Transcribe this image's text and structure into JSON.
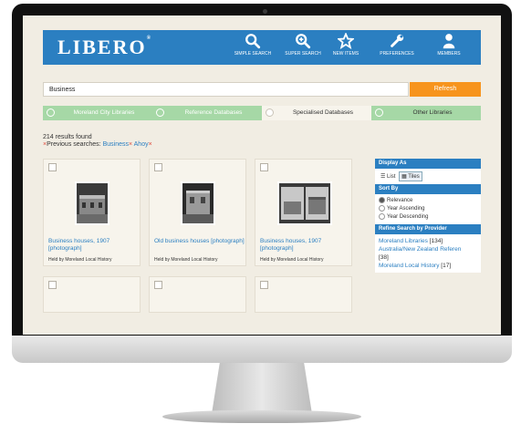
{
  "header": {
    "logo": "LIBERO",
    "nav": [
      {
        "label": "SIMPLE SEARCH",
        "icon": "search-icon"
      },
      {
        "label": "SUPER SEARCH",
        "icon": "zoom-plus-icon"
      },
      {
        "label": "NEW ITEMS",
        "icon": "star-icon"
      },
      {
        "label": "PREFERENCES",
        "icon": "wrench-icon"
      },
      {
        "label": "MEMBERS",
        "icon": "user-icon"
      }
    ]
  },
  "search": {
    "value": "Business",
    "refresh_label": "Refresh"
  },
  "databases": [
    {
      "label": "Moreland City Libraries",
      "selected": true
    },
    {
      "label": "Reference Databases",
      "selected": true
    },
    {
      "label": "Specialised Databases",
      "selected": false
    },
    {
      "label": "Other Libraries",
      "selected": true
    }
  ],
  "results": {
    "count_text": "214 results found",
    "prev_label": "Previous searches:",
    "prev_items": [
      "Business",
      "Ahoy"
    ],
    "remove_glyph": "×"
  },
  "cards": [
    {
      "title": "Business houses, 1907 [photograph]",
      "held": "Held by Moreland Local History"
    },
    {
      "title": "Old business houses [photograph]",
      "held": "Held by Moreland Local History"
    },
    {
      "title": "Business houses, 1907 [photograph]",
      "held": "Held by Moreland Local History"
    }
  ],
  "sidebar": {
    "display_as": {
      "title": "Display As",
      "options": [
        "List",
        "Tiles"
      ],
      "selected": "Tiles"
    },
    "sort_by": {
      "title": "Sort By",
      "options": [
        "Relevance",
        "Year Ascending",
        "Year Descending"
      ],
      "selected": "Relevance"
    },
    "refine": {
      "title": "Refine Search by Provider",
      "providers": [
        {
          "name": "Moreland Libraries",
          "count": "[134]"
        },
        {
          "name": "Australia/New Zealand Referen",
          "count": "[38]"
        },
        {
          "name": "Moreland Local History",
          "count": "[17]"
        }
      ]
    }
  },
  "colors": {
    "brand": "#2b7fc1",
    "accent": "#f7941d",
    "selected_tab": "#a6d8a6",
    "remove": "#e04a3b"
  }
}
